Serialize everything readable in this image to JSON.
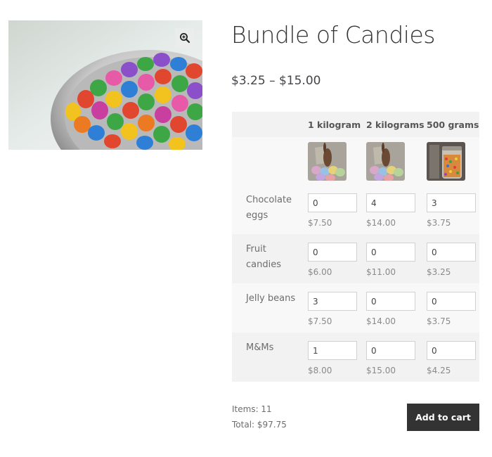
{
  "product": {
    "title": "Bundle of Candies",
    "price_range": "$3.25 – $15.00",
    "gallery_icon": "zoom-in-icon"
  },
  "table": {
    "columns": [
      "1 kilogram",
      "2 kilograms",
      "500 grams"
    ],
    "rows": [
      {
        "label": "Chocolate eggs",
        "quantities": [
          "0",
          "4",
          "3"
        ],
        "prices": [
          "$7.50",
          "$14.00",
          "$3.75"
        ]
      },
      {
        "label": "Fruit candies",
        "quantities": [
          "0",
          "0",
          "0"
        ],
        "prices": [
          "$6.00",
          "$11.00",
          "$3.25"
        ]
      },
      {
        "label": "Jelly beans",
        "quantities": [
          "3",
          "0",
          "0"
        ],
        "prices": [
          "$7.50",
          "$14.00",
          "$3.75"
        ]
      },
      {
        "label": "M&Ms",
        "quantities": [
          "1",
          "0",
          "0"
        ],
        "prices": [
          "$8.00",
          "$15.00",
          "$4.25"
        ]
      }
    ]
  },
  "summary": {
    "items": "Items: 11",
    "total": "Total: $97.75"
  },
  "add_to_cart_label": "Add to cart"
}
